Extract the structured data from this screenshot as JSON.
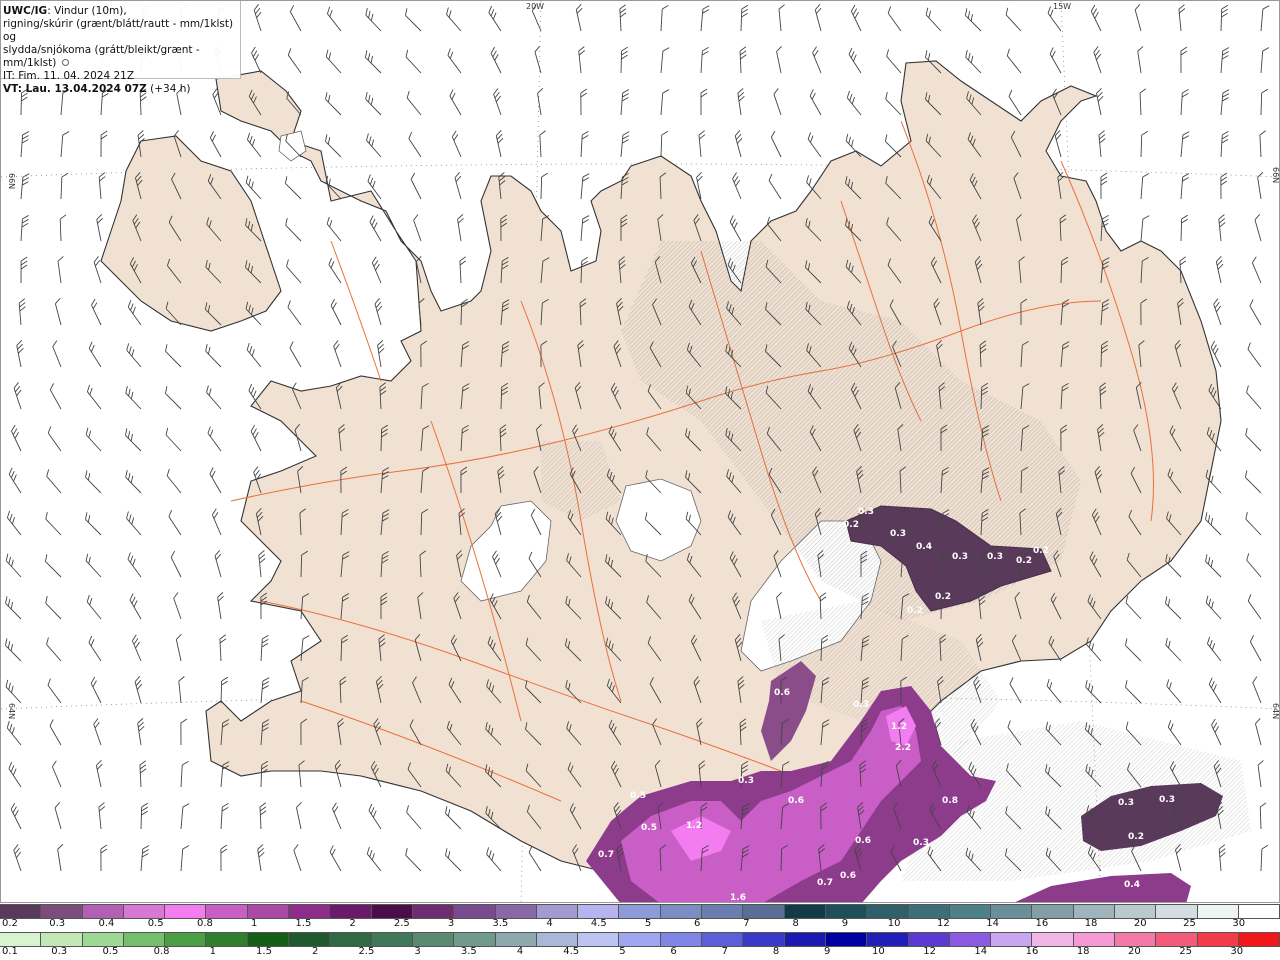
{
  "header": {
    "product": "UWC/IG",
    "line1_rest": ": Vindur (10m),",
    "line2": "rigning/skúrir (grænt/blátt/rautt - mm/1klst) og",
    "line3": "slydda/snjókoma (grátt/bleikt/grænt - mm/1klst)",
    "issue_time": "IT: Fim. 11. 04. 2024 21Z",
    "valid_prefix": "VT: Lau. 13.04.2024 07Z",
    "valid_offset": " (+34 h)"
  },
  "axes": {
    "lon_labels": [
      "20W",
      "15W"
    ],
    "lat_labels_left": [
      "66N",
      "64N"
    ],
    "lat_labels_right": [
      "66N",
      "64N"
    ]
  },
  "precip_values": [
    "0.3",
    "0.2",
    "0.3",
    "0.4",
    "0.3",
    "0.3",
    "0.2",
    "0.2",
    "0.2",
    "0.2",
    "0.6",
    "0.3",
    "1.2",
    "2.2",
    "0.3",
    "0.5",
    "0.6",
    "1.2",
    "0.5",
    "0.8",
    "0.6",
    "0.6",
    "0.3",
    "0.7",
    "0.7",
    "1.6",
    "0.3",
    "0.3",
    "0.2",
    "0.4"
  ],
  "legend_top": {
    "colors": [
      "#5a3a5a",
      "#7a4d7d",
      "#b25fb4",
      "#d977d6",
      "#f27cf0",
      "#c95ec6",
      "#a84aa6",
      "#8d2c8a",
      "#6b1a6b",
      "#4a0d4a",
      "#6d2d70",
      "#7a4a8e",
      "#8a68a8",
      "#a39ad0",
      "#b5b3f0",
      "#8f9ad8",
      "#7a8ec4",
      "#6a7eb0",
      "#5a6e96",
      "#123a48",
      "#1f4e5a",
      "#2f5f6a",
      "#3e6f78",
      "#4e8088",
      "#6a8f98",
      "#849ea6",
      "#9fb4bc",
      "#b9c9cc",
      "#d4dee0",
      "#eef3f3",
      "#ffffff"
    ],
    "labels": [
      "0.2",
      "0.3",
      "0.4",
      "0.5",
      "0.8",
      "1",
      "1.5",
      "2",
      "2.5",
      "3",
      "3.5",
      "4",
      "4.5",
      "5",
      "6",
      "7",
      "8",
      "9",
      "10",
      "12",
      "14",
      "16",
      "18",
      "20",
      "25",
      "30"
    ]
  },
  "legend_bottom": {
    "colors": [
      "#d8f3d0",
      "#c2e8b8",
      "#9ed895",
      "#74be6c",
      "#4a9f45",
      "#2f7f2e",
      "#145e18",
      "#1e5a2e",
      "#2f6a44",
      "#40785a",
      "#5a8a72",
      "#6f9a8c",
      "#8ea8ad",
      "#a9b8d6",
      "#bdc4f2",
      "#9fa8ee",
      "#7f86e6",
      "#5c5fd8",
      "#3a3ac8",
      "#1a1ab0",
      "#0000a0",
      "#2020b8",
      "#5a3ad0",
      "#8a5ae0",
      "#c8a6f0",
      "#f0b6e8",
      "#f59ad4",
      "#f27aa8",
      "#f25c7a",
      "#f23c4c",
      "#f01818"
    ],
    "labels": [
      "0.1",
      "0.3",
      "0.5",
      "0.8",
      "1",
      "1.5",
      "2",
      "2.5",
      "3",
      "3.5",
      "4",
      "4.5",
      "5",
      "6",
      "7",
      "8",
      "9",
      "10",
      "12",
      "14",
      "16",
      "18",
      "20",
      "25",
      "30"
    ]
  }
}
